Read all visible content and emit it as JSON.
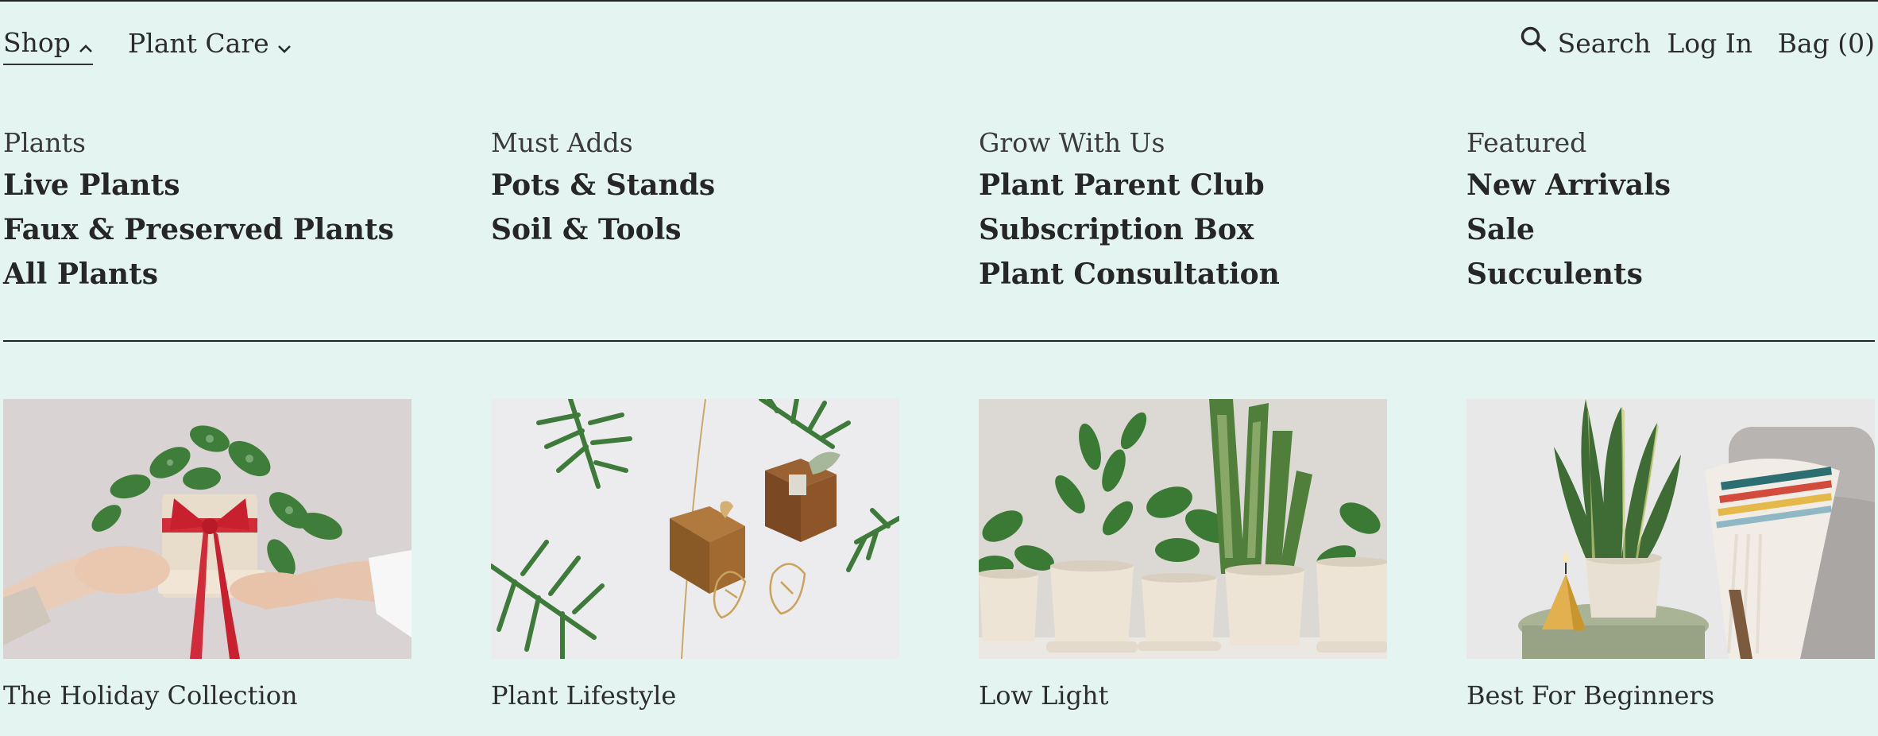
{
  "nav": {
    "shop_label": "Shop",
    "plant_care_label": "Plant Care",
    "search_label": "Search",
    "login_label": "Log In",
    "bag_label": "Bag (0)"
  },
  "menu": {
    "columns": [
      {
        "heading": "Plants",
        "links": [
          "Live Plants",
          "Faux & Preserved Plants",
          "All Plants"
        ]
      },
      {
        "heading": "Must Adds",
        "links": [
          "Pots & Stands",
          "Soil & Tools"
        ]
      },
      {
        "heading": "Grow With Us",
        "links": [
          "Plant Parent Club",
          "Subscription Box",
          "Plant Consultation"
        ]
      },
      {
        "heading": "Featured",
        "links": [
          "New Arrivals",
          "Sale",
          "Succulents"
        ]
      }
    ]
  },
  "cards": [
    {
      "caption": "The Holiday Collection",
      "image": "holiday-gift-plant-photo"
    },
    {
      "caption": "Plant Lifestyle",
      "image": "plant-lifestyle-accessories-photo"
    },
    {
      "caption": "Low Light",
      "image": "low-light-potted-plants-photo"
    },
    {
      "caption": "Best For Beginners",
      "image": "snake-plant-living-room-photo"
    }
  ],
  "colors": {
    "background": "#e4f5f1",
    "text": "#2a2a2a",
    "rule": "#222222"
  }
}
